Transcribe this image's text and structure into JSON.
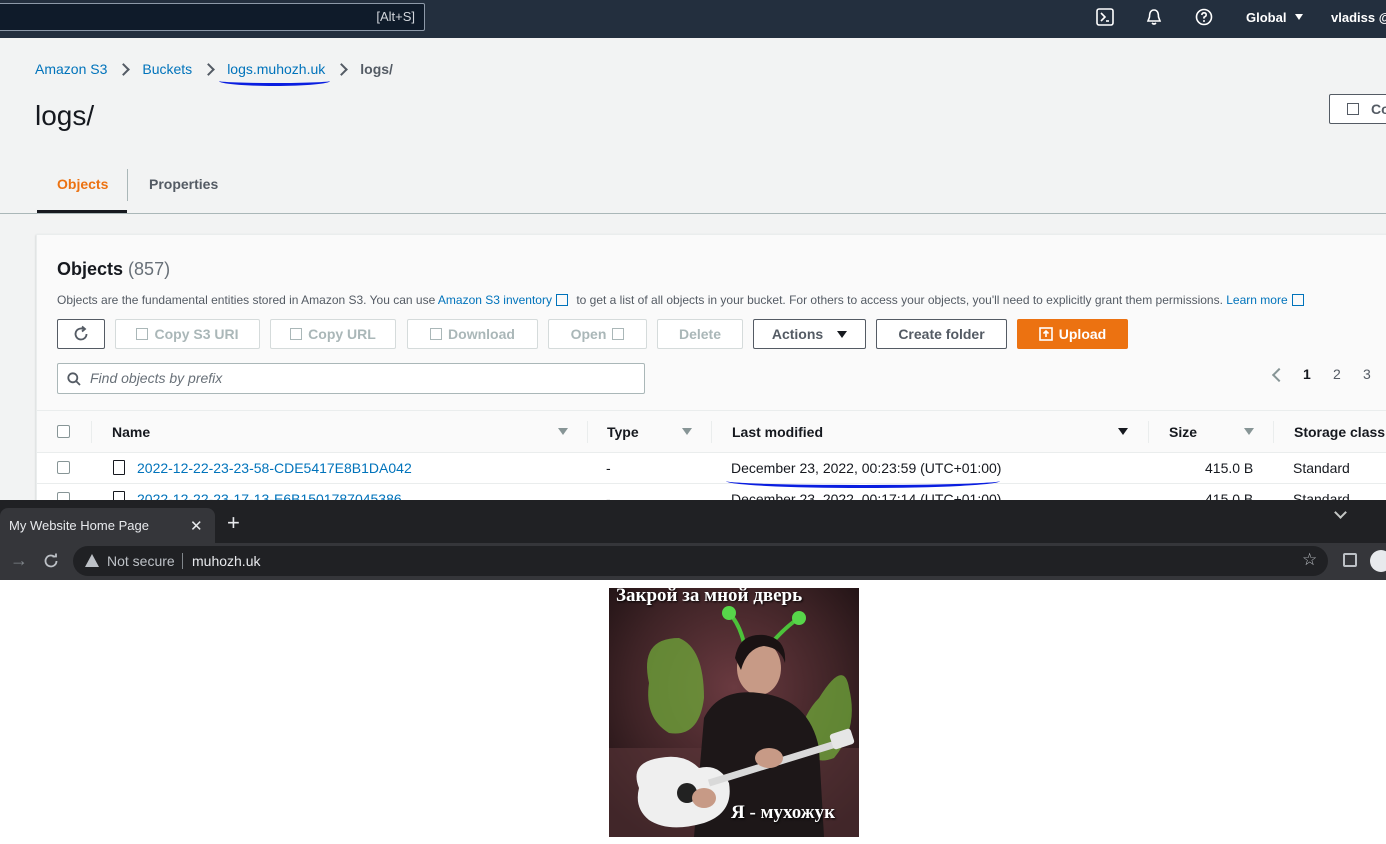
{
  "aws": {
    "search_shortcut": "[Alt+S]",
    "region": "Global",
    "user": "vladiss @"
  },
  "breadcrumbs": [
    "Amazon S3",
    "Buckets",
    "logs.muhozh.uk",
    "logs/"
  ],
  "page_title": "logs/",
  "copy_button_label": "Co",
  "tabs": [
    "Objects",
    "Properties"
  ],
  "objects_panel": {
    "title": "Objects",
    "count": "(857)",
    "desc_1": "Objects are the fundamental entities stored in Amazon S3. You can use ",
    "desc_link_1": "Amazon S3 inventory",
    "desc_2": " to get a list of all objects in your bucket. For others to access your objects, you'll need to explicitly grant them permissions. ",
    "desc_link_2": "Learn more",
    "buttons": {
      "copy_s3_uri": "Copy S3 URI",
      "copy_url": "Copy URL",
      "download": "Download",
      "open": "Open",
      "delete": "Delete",
      "actions": "Actions",
      "create_folder": "Create folder",
      "upload": "Upload"
    },
    "search_placeholder": "Find objects by prefix",
    "pages": [
      "1",
      "2",
      "3"
    ],
    "columns": [
      "Name",
      "Type",
      "Last modified",
      "Size",
      "Storage class"
    ],
    "rows": [
      {
        "name": "2022-12-22-23-23-58-CDE5417E8B1DA042",
        "type": "-",
        "modified": "December 23, 2022, 00:23:59 (UTC+01:00)",
        "size": "415.0 B",
        "storage": "Standard"
      },
      {
        "name": "2022-12-22-23-17-13-E6B1501787045386",
        "type": "-",
        "modified": "December 23, 2022, 00:17:14 (UTC+01:00)",
        "size": "415.0 B",
        "storage": "Standard"
      }
    ]
  },
  "browser": {
    "tab_title": "My Website Home Page",
    "not_secure": "Not secure",
    "url": "muhozh.uk"
  },
  "website": {
    "caption_top": "Закрой за мной дверь",
    "caption_bottom": "Я - мухожук"
  },
  "colors": {
    "aws_nav": "#232f3e",
    "link": "#0073bb",
    "accent_orange": "#ec7211",
    "annotation_blue": "#0a1ee0"
  }
}
